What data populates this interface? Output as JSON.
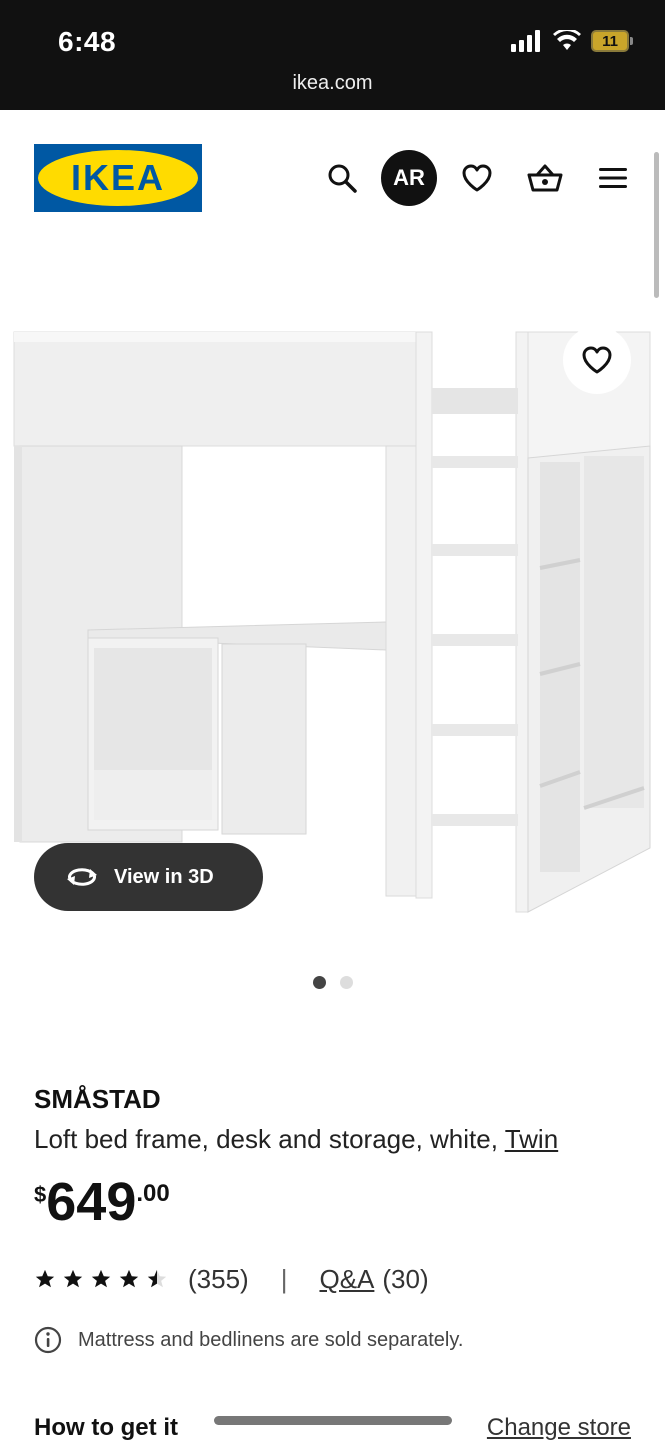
{
  "status_bar": {
    "time": "6:48",
    "battery": "11",
    "url": "ikea.com"
  },
  "header": {
    "logo_text": "IKEA",
    "ar_label": "AR",
    "brand_colors": {
      "blue": "#0058A3",
      "yellow": "#FFDB00"
    }
  },
  "gallery": {
    "view3d_label": "View in 3D",
    "page_count": 2,
    "active_page": 1
  },
  "product": {
    "name": "SMÅSTAD",
    "description": "Loft bed frame, desk and storage, white,",
    "variant": "Twin",
    "price_currency": "$",
    "price_int": "649",
    "price_dec": ".00",
    "rating": 4.5,
    "review_count": "(355)",
    "separator": "|",
    "qa_label": "Q&A",
    "qa_count": "(30)",
    "notice": "Mattress and bedlinens are sold separately."
  },
  "fulfillment": {
    "heading": "How to get it",
    "change_store_label": "Change store"
  }
}
